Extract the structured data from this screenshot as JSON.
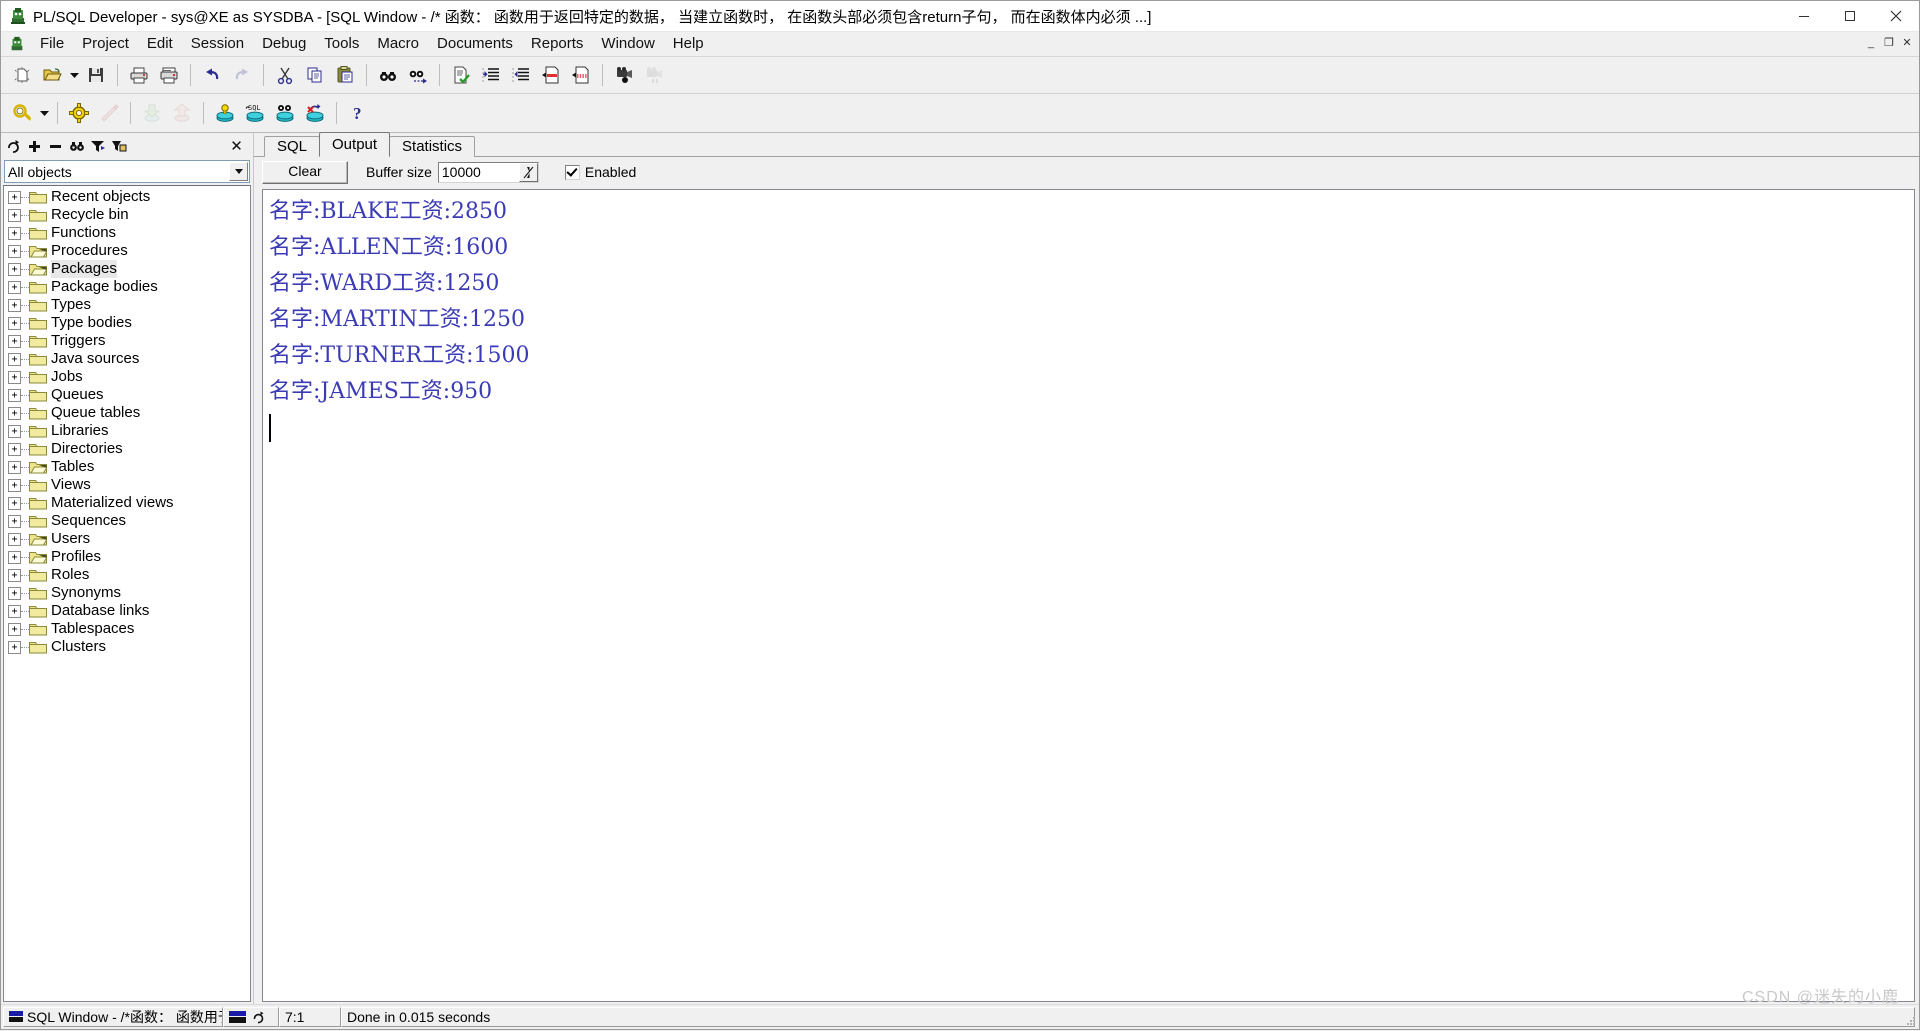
{
  "window": {
    "title": "PL/SQL Developer - sys@XE as SYSDBA - [SQL Window - /* 函数： 函数用于返回特定的数据， 当建立函数时， 在函数头部必须包含return子句， 而在函数体内必须 ...]",
    "app_icon": "plsql-developer-icon",
    "controls": {
      "minimize": "minimize-icon",
      "maximize": "maximize-icon",
      "close": "close-icon"
    },
    "mdi_controls": {
      "minimize": "_",
      "restore": "❐",
      "close": "✕"
    }
  },
  "menubar": {
    "logo": "plsql-logo-icon",
    "items": [
      {
        "label": "File"
      },
      {
        "label": "Project"
      },
      {
        "label": "Edit"
      },
      {
        "label": "Session"
      },
      {
        "label": "Debug"
      },
      {
        "label": "Tools"
      },
      {
        "label": "Macro"
      },
      {
        "label": "Documents"
      },
      {
        "label": "Reports"
      },
      {
        "label": "Window"
      },
      {
        "label": "Help"
      }
    ]
  },
  "toolbar_row1": [
    {
      "name": "new-icon",
      "kind": "icon",
      "disabled": false
    },
    {
      "name": "open-icon",
      "kind": "icon",
      "disabled": false
    },
    {
      "name": "open-dropdown-icon",
      "kind": "dropdown",
      "disabled": false
    },
    {
      "name": "save-icon",
      "kind": "icon",
      "disabled": false
    },
    {
      "name": "separator",
      "kind": "sep"
    },
    {
      "name": "print-icon",
      "kind": "icon",
      "disabled": false
    },
    {
      "name": "print-preview-icon",
      "kind": "icon",
      "disabled": false
    },
    {
      "name": "separator",
      "kind": "sep"
    },
    {
      "name": "undo-icon",
      "kind": "icon",
      "disabled": false
    },
    {
      "name": "redo-icon",
      "kind": "icon",
      "disabled": true
    },
    {
      "name": "separator",
      "kind": "sep"
    },
    {
      "name": "cut-icon",
      "kind": "icon",
      "disabled": false
    },
    {
      "name": "copy-icon",
      "kind": "icon",
      "disabled": false
    },
    {
      "name": "paste-icon",
      "kind": "icon",
      "disabled": false
    },
    {
      "name": "separator",
      "kind": "sep"
    },
    {
      "name": "find-icon",
      "kind": "icon",
      "disabled": false
    },
    {
      "name": "find-next-icon",
      "kind": "icon",
      "disabled": false
    },
    {
      "name": "separator",
      "kind": "sep"
    },
    {
      "name": "check-syntax-icon",
      "kind": "icon",
      "disabled": false
    },
    {
      "name": "indent-icon",
      "kind": "icon",
      "disabled": false
    },
    {
      "name": "unindent-icon",
      "kind": "icon",
      "disabled": false
    },
    {
      "name": "comment-icon",
      "kind": "icon",
      "disabled": false
    },
    {
      "name": "uncomment-icon",
      "kind": "icon",
      "disabled": false
    },
    {
      "name": "separator",
      "kind": "sep"
    },
    {
      "name": "record-macro-icon",
      "kind": "icon",
      "disabled": false
    },
    {
      "name": "play-macro-icon",
      "kind": "icon",
      "disabled": true
    }
  ],
  "toolbar_row2": [
    {
      "name": "explain-plan-icon",
      "kind": "icon",
      "disabled": false
    },
    {
      "name": "explain-plan-dropdown-icon",
      "kind": "dropdown",
      "disabled": false
    },
    {
      "name": "separator",
      "kind": "sep"
    },
    {
      "name": "compile-icon",
      "kind": "icon",
      "disabled": false
    },
    {
      "name": "test-icon",
      "kind": "icon",
      "disabled": true
    },
    {
      "name": "separator",
      "kind": "sep"
    },
    {
      "name": "import-icon",
      "kind": "icon",
      "disabled": true
    },
    {
      "name": "export-icon",
      "kind": "icon",
      "disabled": true
    },
    {
      "name": "separator",
      "kind": "sep"
    },
    {
      "name": "session-info-icon",
      "kind": "icon",
      "disabled": false
    },
    {
      "name": "sql-session-icon",
      "kind": "icon",
      "disabled": false
    },
    {
      "name": "find-database-object-icon",
      "kind": "icon",
      "disabled": false
    },
    {
      "name": "rollback-icon",
      "kind": "icon",
      "disabled": false
    },
    {
      "name": "separator",
      "kind": "sep"
    },
    {
      "name": "help-icon",
      "kind": "icon",
      "disabled": false
    }
  ],
  "browser": {
    "toolbar": [
      {
        "name": "refresh-icon",
        "glyph": "↻"
      },
      {
        "name": "expand-icon",
        "glyph": "✛"
      },
      {
        "name": "collapse-icon",
        "glyph": "━"
      },
      {
        "name": "find-icon",
        "glyph": "binoculars"
      },
      {
        "name": "filter-icon",
        "glyph": "funnel"
      },
      {
        "name": "organize-icon",
        "glyph": "organize"
      }
    ],
    "close_label": "✕",
    "filter": {
      "value": "All objects",
      "arrow": "▼"
    },
    "tree": [
      {
        "label": "Recent objects",
        "icon": "folder-closed-icon",
        "expander": "+"
      },
      {
        "label": "Recycle bin",
        "icon": "folder-closed-icon",
        "expander": "+"
      },
      {
        "label": "Functions",
        "icon": "folder-closed-icon",
        "expander": "+"
      },
      {
        "label": "Procedures",
        "icon": "folder-open-icon",
        "expander": "+"
      },
      {
        "label": "Packages",
        "icon": "folder-open-icon",
        "expander": "+",
        "selected": true
      },
      {
        "label": "Package bodies",
        "icon": "folder-closed-icon",
        "expander": "+"
      },
      {
        "label": "Types",
        "icon": "folder-closed-icon",
        "expander": "+"
      },
      {
        "label": "Type bodies",
        "icon": "folder-closed-icon",
        "expander": "+"
      },
      {
        "label": "Triggers",
        "icon": "folder-closed-icon",
        "expander": "+"
      },
      {
        "label": "Java sources",
        "icon": "folder-closed-icon",
        "expander": "+"
      },
      {
        "label": "Jobs",
        "icon": "folder-closed-icon",
        "expander": "+"
      },
      {
        "label": "Queues",
        "icon": "folder-closed-icon",
        "expander": "+"
      },
      {
        "label": "Queue tables",
        "icon": "folder-closed-icon",
        "expander": "+"
      },
      {
        "label": "Libraries",
        "icon": "folder-closed-icon",
        "expander": "+"
      },
      {
        "label": "Directories",
        "icon": "folder-closed-icon",
        "expander": "+"
      },
      {
        "label": "Tables",
        "icon": "folder-open-icon",
        "expander": "+"
      },
      {
        "label": "Views",
        "icon": "folder-closed-icon",
        "expander": "+"
      },
      {
        "label": "Materialized views",
        "icon": "folder-closed-icon",
        "expander": "+"
      },
      {
        "label": "Sequences",
        "icon": "folder-closed-icon",
        "expander": "+"
      },
      {
        "label": "Users",
        "icon": "folder-open-icon",
        "expander": "+"
      },
      {
        "label": "Profiles",
        "icon": "folder-open-icon",
        "expander": "+"
      },
      {
        "label": "Roles",
        "icon": "folder-closed-icon",
        "expander": "+"
      },
      {
        "label": "Synonyms",
        "icon": "folder-closed-icon",
        "expander": "+"
      },
      {
        "label": "Database links",
        "icon": "folder-closed-icon",
        "expander": "+"
      },
      {
        "label": "Tablespaces",
        "icon": "folder-closed-icon",
        "expander": "+"
      },
      {
        "label": "Clusters",
        "icon": "folder-closed-icon",
        "expander": "+"
      }
    ]
  },
  "main": {
    "tabs": [
      {
        "label": "SQL",
        "active": false
      },
      {
        "label": "Output",
        "active": true
      },
      {
        "label": "Statistics",
        "active": false
      }
    ],
    "output_toolbar": {
      "clear_label": "Clear",
      "buffer_size_label": "Buffer size",
      "buffer_size_value": "10000",
      "spinner_glyph": "⇅",
      "enabled_label": "Enabled",
      "enabled_checked": true
    },
    "output_lines": [
      "名字:BLAKE工资:2850",
      "名字:ALLEN工资:1600",
      "名字:WARD工资:1250",
      "名字:MARTIN工资:1250",
      "名字:TURNER工资:1500",
      "名字:JAMES工资:950"
    ],
    "output_text_color": "#3b3bb5"
  },
  "statusbar": {
    "document": "SQL Window - /*函数： 函数用于返!",
    "document_icon": "sql-window-icon",
    "connection_icon": "session-icon",
    "refresh_icon": "refresh-icon",
    "position": "7:1",
    "message": "Done in 0.015 seconds"
  },
  "watermark": "CSDN @迷失的小鹿"
}
